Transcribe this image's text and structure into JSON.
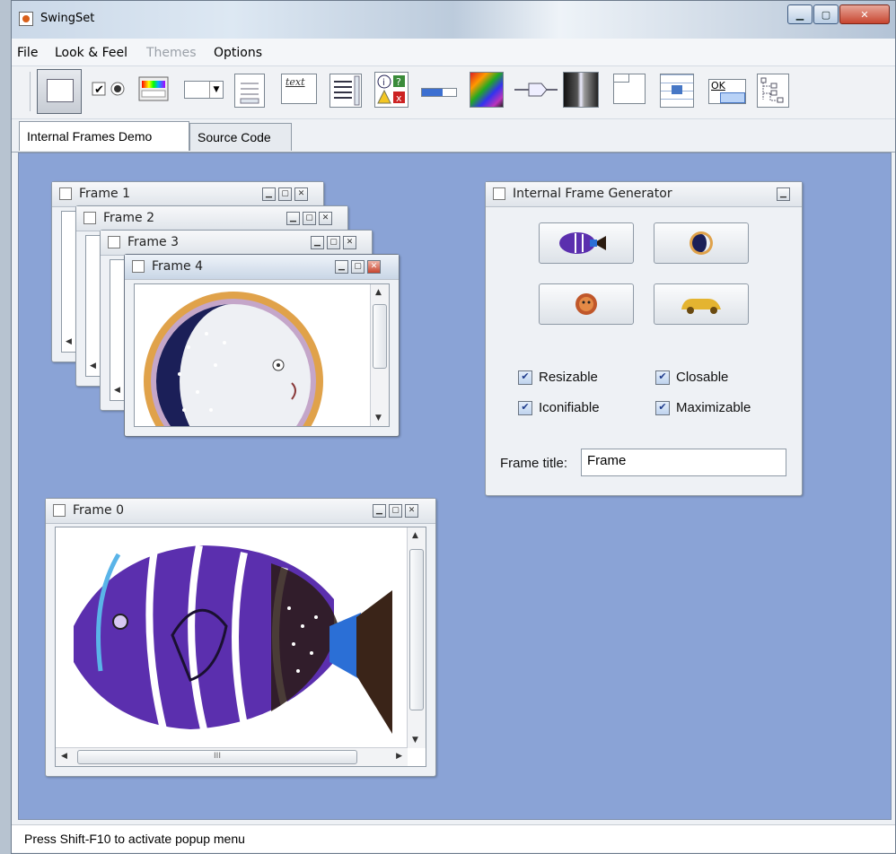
{
  "window": {
    "title": "SwingSet"
  },
  "menu": [
    {
      "label": "File"
    },
    {
      "label": "Look & Feel"
    },
    {
      "label": "Themes"
    },
    {
      "label": "Options"
    }
  ],
  "toolbar_icons": [
    "internal-frames-icon",
    "button-icon",
    "checkbox-radio-icon",
    "color-chooser-icon",
    "combobox-icon",
    "file-chooser-icon",
    "editor-pane-icon",
    "list-icon",
    "option-pane-icon",
    "progress-bar-icon",
    "scroll-pane-icon",
    "slider-icon",
    "split-pane-icon",
    "tabbed-pane-icon",
    "table-icon",
    "tooltip-icon",
    "tree-icon"
  ],
  "tabs": [
    {
      "label": "Internal Frames Demo"
    },
    {
      "label": "Source Code"
    }
  ],
  "frames": {
    "frame0": "Frame 0",
    "frame1": "Frame 1",
    "frame2": "Frame 2",
    "frame3": "Frame 3",
    "frame4": "Frame 4"
  },
  "generator": {
    "title": "Internal Frame Generator",
    "options": {
      "resizable": "Resizable",
      "closable": "Closable",
      "iconifiable": "Iconifiable",
      "maximizable": "Maximizable"
    },
    "frame_title_label": "Frame title:",
    "frame_title_value": "Frame"
  },
  "status": "Press Shift-F10 to activate popup menu",
  "colors": {
    "desktop": "#8aa3d6",
    "fish": "#5b2fae",
    "moon_ring": "#e0a24a"
  }
}
